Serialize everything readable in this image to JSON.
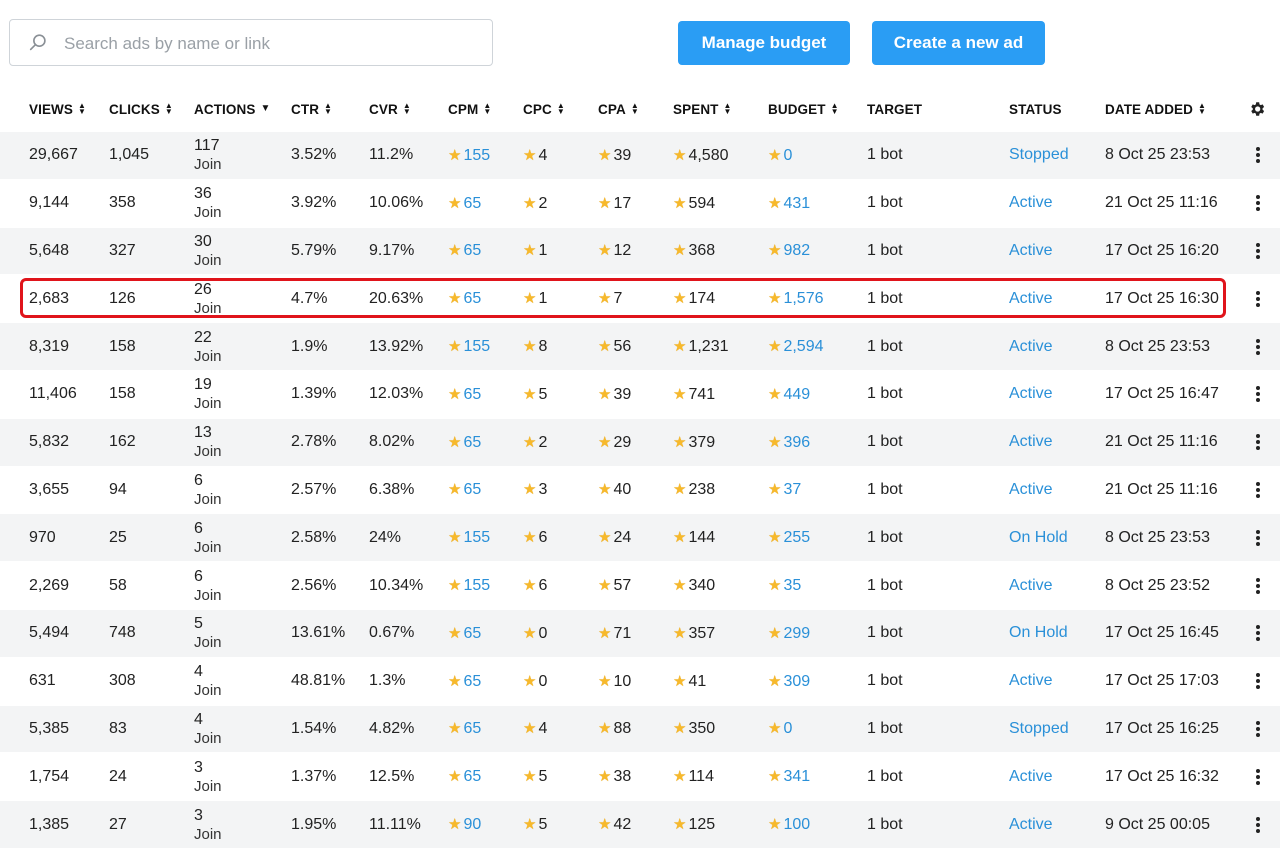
{
  "search": {
    "placeholder": "Search ads by name or link",
    "value": ""
  },
  "buttons": {
    "manage_budget": "Manage budget",
    "create_ad": "Create a new ad"
  },
  "columns": [
    {
      "key": "views",
      "label": "VIEWS",
      "sort": "both"
    },
    {
      "key": "clicks",
      "label": "CLICKS",
      "sort": "both"
    },
    {
      "key": "actions",
      "label": "ACTIONS",
      "sort": "desc"
    },
    {
      "key": "ctr",
      "label": "CTR",
      "sort": "both"
    },
    {
      "key": "cvr",
      "label": "CVR",
      "sort": "both"
    },
    {
      "key": "cpm",
      "label": "CPM",
      "sort": "both"
    },
    {
      "key": "cpc",
      "label": "CPC",
      "sort": "both"
    },
    {
      "key": "cpa",
      "label": "CPA",
      "sort": "both"
    },
    {
      "key": "spent",
      "label": "SPENT",
      "sort": "both"
    },
    {
      "key": "budget",
      "label": "BUDGET",
      "sort": "both"
    },
    {
      "key": "target",
      "label": "TARGET",
      "sort": "none"
    },
    {
      "key": "status",
      "label": "STATUS",
      "sort": "none"
    },
    {
      "key": "date_added",
      "label": "DATE ADDED",
      "sort": "both"
    }
  ],
  "rows": [
    {
      "views": "29,667",
      "clicks": "1,045",
      "actions": "117",
      "action_label": "Join",
      "ctr": "3.52%",
      "cvr": "11.2%",
      "cpm": "155",
      "cpc": "4",
      "cpa": "39",
      "spent": "4,580",
      "budget": "0",
      "target": "1 bot",
      "status": "Stopped",
      "date_added": "8 Oct 25 23:53"
    },
    {
      "views": "9,144",
      "clicks": "358",
      "actions": "36",
      "action_label": "Join",
      "ctr": "3.92%",
      "cvr": "10.06%",
      "cpm": "65",
      "cpc": "2",
      "cpa": "17",
      "spent": "594",
      "budget": "431",
      "target": "1 bot",
      "status": "Active",
      "date_added": "21 Oct 25 11:16"
    },
    {
      "views": "5,648",
      "clicks": "327",
      "actions": "30",
      "action_label": "Join",
      "ctr": "5.79%",
      "cvr": "9.17%",
      "cpm": "65",
      "cpc": "1",
      "cpa": "12",
      "spent": "368",
      "budget": "982",
      "target": "1 bot",
      "status": "Active",
      "date_added": "17 Oct 25 16:20"
    },
    {
      "views": "2,683",
      "clicks": "126",
      "actions": "26",
      "action_label": "Join",
      "ctr": "4.7%",
      "cvr": "20.63%",
      "cpm": "65",
      "cpc": "1",
      "cpa": "7",
      "spent": "174",
      "budget": "1,576",
      "target": "1 bot",
      "status": "Active",
      "date_added": "17 Oct 25 16:30"
    },
    {
      "views": "8,319",
      "clicks": "158",
      "actions": "22",
      "action_label": "Join",
      "ctr": "1.9%",
      "cvr": "13.92%",
      "cpm": "155",
      "cpc": "8",
      "cpa": "56",
      "spent": "1,231",
      "budget": "2,594",
      "target": "1 bot",
      "status": "Active",
      "date_added": "8 Oct 25 23:53"
    },
    {
      "views": "11,406",
      "clicks": "158",
      "actions": "19",
      "action_label": "Join",
      "ctr": "1.39%",
      "cvr": "12.03%",
      "cpm": "65",
      "cpc": "5",
      "cpa": "39",
      "spent": "741",
      "budget": "449",
      "target": "1 bot",
      "status": "Active",
      "date_added": "17 Oct 25 16:47"
    },
    {
      "views": "5,832",
      "clicks": "162",
      "actions": "13",
      "action_label": "Join",
      "ctr": "2.78%",
      "cvr": "8.02%",
      "cpm": "65",
      "cpc": "2",
      "cpa": "29",
      "spent": "379",
      "budget": "396",
      "target": "1 bot",
      "status": "Active",
      "date_added": "21 Oct 25 11:16"
    },
    {
      "views": "3,655",
      "clicks": "94",
      "actions": "6",
      "action_label": "Join",
      "ctr": "2.57%",
      "cvr": "6.38%",
      "cpm": "65",
      "cpc": "3",
      "cpa": "40",
      "spent": "238",
      "budget": "37",
      "target": "1 bot",
      "status": "Active",
      "date_added": "21 Oct 25 11:16"
    },
    {
      "views": "970",
      "clicks": "25",
      "actions": "6",
      "action_label": "Join",
      "ctr": "2.58%",
      "cvr": "24%",
      "cpm": "155",
      "cpc": "6",
      "cpa": "24",
      "spent": "144",
      "budget": "255",
      "target": "1 bot",
      "status": "On Hold",
      "date_added": "8 Oct 25 23:53"
    },
    {
      "views": "2,269",
      "clicks": "58",
      "actions": "6",
      "action_label": "Join",
      "ctr": "2.56%",
      "cvr": "10.34%",
      "cpm": "155",
      "cpc": "6",
      "cpa": "57",
      "spent": "340",
      "budget": "35",
      "target": "1 bot",
      "status": "Active",
      "date_added": "8 Oct 25 23:52"
    },
    {
      "views": "5,494",
      "clicks": "748",
      "actions": "5",
      "action_label": "Join",
      "ctr": "13.61%",
      "cvr": "0.67%",
      "cpm": "65",
      "cpc": "0",
      "cpa": "71",
      "spent": "357",
      "budget": "299",
      "target": "1 bot",
      "status": "On Hold",
      "date_added": "17 Oct 25 16:45"
    },
    {
      "views": "631",
      "clicks": "308",
      "actions": "4",
      "action_label": "Join",
      "ctr": "48.81%",
      "cvr": "1.3%",
      "cpm": "65",
      "cpc": "0",
      "cpa": "10",
      "spent": "41",
      "budget": "309",
      "target": "1 bot",
      "status": "Active",
      "date_added": "17 Oct 25 17:03"
    },
    {
      "views": "5,385",
      "clicks": "83",
      "actions": "4",
      "action_label": "Join",
      "ctr": "1.54%",
      "cvr": "4.82%",
      "cpm": "65",
      "cpc": "4",
      "cpa": "88",
      "spent": "350",
      "budget": "0",
      "target": "1 bot",
      "status": "Stopped",
      "date_added": "17 Oct 25 16:25"
    },
    {
      "views": "1,754",
      "clicks": "24",
      "actions": "3",
      "action_label": "Join",
      "ctr": "1.37%",
      "cvr": "12.5%",
      "cpm": "65",
      "cpc": "5",
      "cpa": "38",
      "spent": "114",
      "budget": "341",
      "target": "1 bot",
      "status": "Active",
      "date_added": "17 Oct 25 16:32"
    },
    {
      "views": "1,385",
      "clicks": "27",
      "actions": "3",
      "action_label": "Join",
      "ctr": "1.95%",
      "cvr": "11.11%",
      "cpm": "90",
      "cpc": "5",
      "cpa": "42",
      "spent": "125",
      "budget": "100",
      "target": "1 bot",
      "status": "Active",
      "date_added": "9 Oct 25 00:05"
    }
  ],
  "highlighted_row": 3,
  "icons": {
    "search": "search-icon",
    "settings": "gear-icon",
    "row_menu": "more-vertical-icon",
    "currency": "star-icon"
  },
  "colors": {
    "accent": "#2a9df4",
    "link": "#2a90d8",
    "star": "#f7b92b",
    "highlight": "#e0141b",
    "row_stripe": "#f3f4f5"
  }
}
